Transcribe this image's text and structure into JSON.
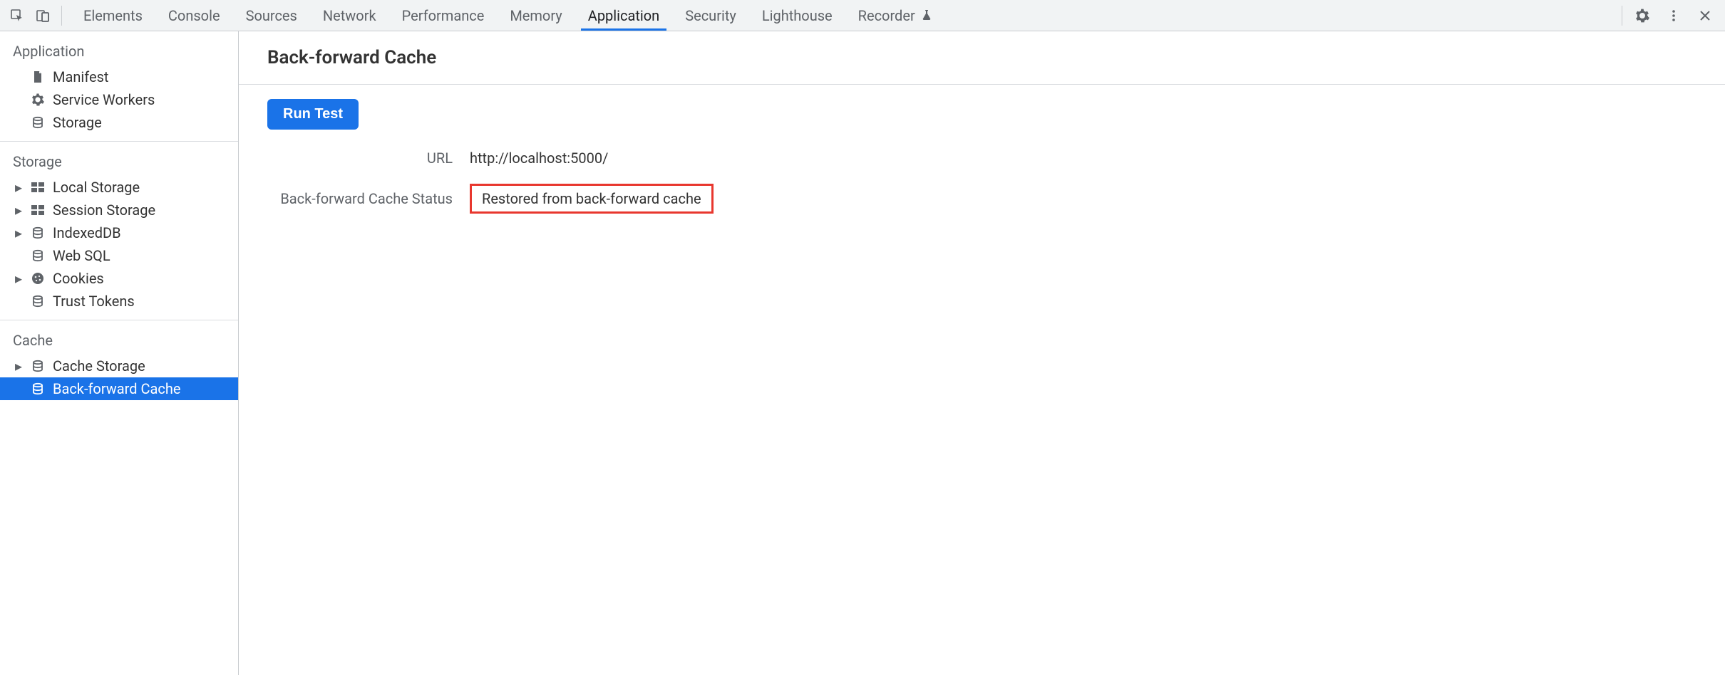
{
  "tabs": {
    "items": [
      "Elements",
      "Console",
      "Sources",
      "Network",
      "Performance",
      "Memory",
      "Application",
      "Security",
      "Lighthouse",
      "Recorder"
    ],
    "active_index": 6,
    "recorder_has_flask_icon": true
  },
  "sidebar": {
    "sections": {
      "application": {
        "title": "Application",
        "items": [
          {
            "label": "Manifest",
            "icon": "file",
            "expandable": false
          },
          {
            "label": "Service Workers",
            "icon": "gear",
            "expandable": false
          },
          {
            "label": "Storage",
            "icon": "db",
            "expandable": false
          }
        ]
      },
      "storage": {
        "title": "Storage",
        "items": [
          {
            "label": "Local Storage",
            "icon": "grid",
            "expandable": true
          },
          {
            "label": "Session Storage",
            "icon": "grid",
            "expandable": true
          },
          {
            "label": "IndexedDB",
            "icon": "db",
            "expandable": true
          },
          {
            "label": "Web SQL",
            "icon": "db",
            "expandable": false
          },
          {
            "label": "Cookies",
            "icon": "cookie",
            "expandable": true
          },
          {
            "label": "Trust Tokens",
            "icon": "db",
            "expandable": false
          }
        ]
      },
      "cache": {
        "title": "Cache",
        "items": [
          {
            "label": "Cache Storage",
            "icon": "db",
            "expandable": true
          },
          {
            "label": "Back-forward Cache",
            "icon": "db",
            "expandable": false,
            "selected": true
          }
        ]
      }
    }
  },
  "content": {
    "heading": "Back-forward Cache",
    "run_test_label": "Run Test",
    "url_key": "URL",
    "url_value": "http://localhost:5000/",
    "status_key": "Back-forward Cache Status",
    "status_value": "Restored from back-forward cache",
    "status_highlighted": true
  }
}
